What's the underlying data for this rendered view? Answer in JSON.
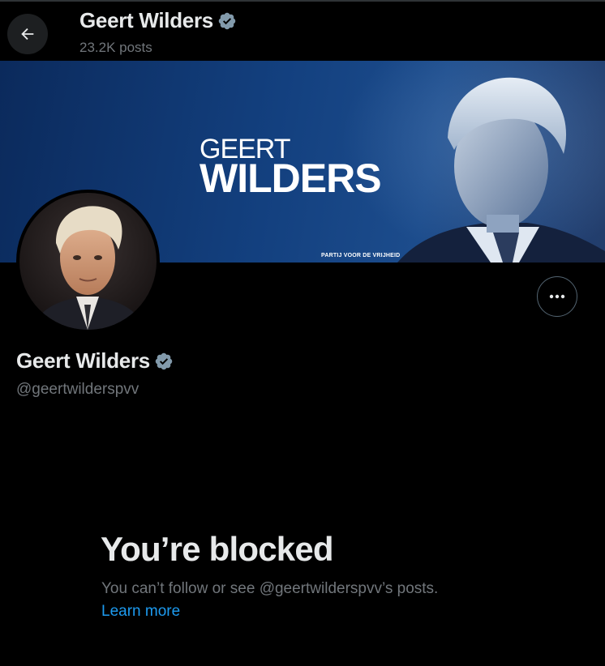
{
  "header": {
    "title": "Geert Wilders",
    "posts_count": "23.2K posts",
    "back_icon": "arrow-left-icon"
  },
  "banner": {
    "logo_first": "GEERT",
    "logo_last": "WILDERS",
    "party_line": "PARTIJ VOOR DE VRIJHEID"
  },
  "profile": {
    "name": "Geert Wilders",
    "handle": "@geertwilderspvv",
    "verified_icon": "verified-badge-icon",
    "more_icon": "more-horizontal-icon"
  },
  "blocked": {
    "title": "You’re blocked",
    "description": "You can’t follow or see @geertwilderspvv’s posts.",
    "link": "Learn more"
  },
  "colors": {
    "background": "#000000",
    "text_primary": "#e7e9ea",
    "text_secondary": "#71767b",
    "link": "#1d9bf0",
    "verified": "#829aab",
    "banner_blue": "#13407f"
  }
}
